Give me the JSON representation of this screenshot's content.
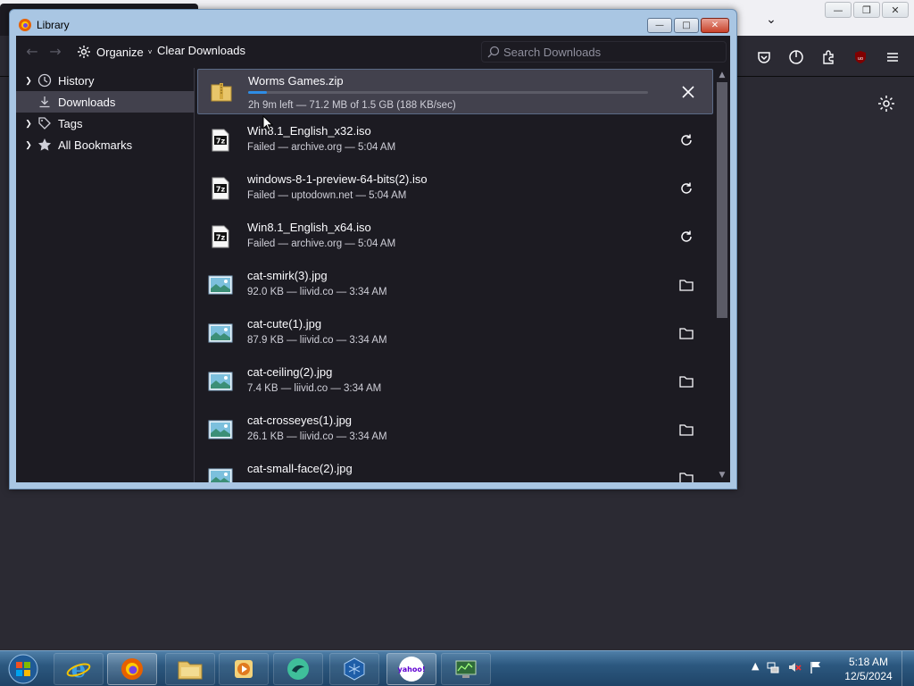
{
  "background_browser": {
    "toolbar_icons": [
      "pocket-icon",
      "sync-icon",
      "extensions-icon",
      "ublock-icon",
      "menu-icon"
    ],
    "settings_icon": "gear-icon"
  },
  "library": {
    "title": "Library",
    "toolbar": {
      "organize_label": "Organize",
      "clear_downloads_label": "Clear Downloads",
      "search_placeholder": "Search Downloads"
    },
    "sidebar": [
      {
        "label": "History",
        "icon": "history-icon",
        "expandable": true
      },
      {
        "label": "Downloads",
        "icon": "download-icon",
        "expandable": false,
        "selected": true
      },
      {
        "label": "Tags",
        "icon": "tag-icon",
        "expandable": true
      },
      {
        "label": "All Bookmarks",
        "icon": "star-icon",
        "expandable": true
      }
    ],
    "downloads": [
      {
        "name": "Worms Games.zip",
        "status": "2h 9m left — 71.2 MB of 1.5 GB (188 KB/sec)",
        "type": "zip",
        "action": "cancel",
        "progress": 0.047
      },
      {
        "name": "Win8.1_English_x32.iso",
        "status": "Failed — archive.org — 5:04 AM",
        "type": "7z",
        "action": "retry"
      },
      {
        "name": "windows-8-1-preview-64-bits(2).iso",
        "status": "Failed — uptodown.net — 5:04 AM",
        "type": "7z",
        "action": "retry"
      },
      {
        "name": "Win8.1_English_x64.iso",
        "status": "Failed — archive.org — 5:04 AM",
        "type": "7z",
        "action": "retry"
      },
      {
        "name": "cat-smirk(3).jpg",
        "status": "92.0 KB — liivid.co — 3:34 AM",
        "type": "image",
        "action": "folder"
      },
      {
        "name": "cat-cute(1).jpg",
        "status": "87.9 KB — liivid.co — 3:34 AM",
        "type": "image",
        "action": "folder"
      },
      {
        "name": "cat-ceiling(2).jpg",
        "status": "7.4 KB — liivid.co — 3:34 AM",
        "type": "image",
        "action": "folder"
      },
      {
        "name": "cat-crosseyes(1).jpg",
        "status": "26.1 KB — liivid.co — 3:34 AM",
        "type": "image",
        "action": "folder"
      },
      {
        "name": "cat-small-face(2).jpg",
        "status": "",
        "type": "image",
        "action": "folder"
      }
    ]
  },
  "taskbar": {
    "apps": [
      "internet-explorer-icon",
      "firefox-icon",
      "file-explorer-icon",
      "media-player-icon",
      "app-icon",
      "virtualbox-icon",
      "yahoo-icon",
      "network-monitor-icon"
    ],
    "yahoo_label": "yahoo!",
    "clock_time": "5:18 AM",
    "clock_date": "12/5/2024"
  }
}
